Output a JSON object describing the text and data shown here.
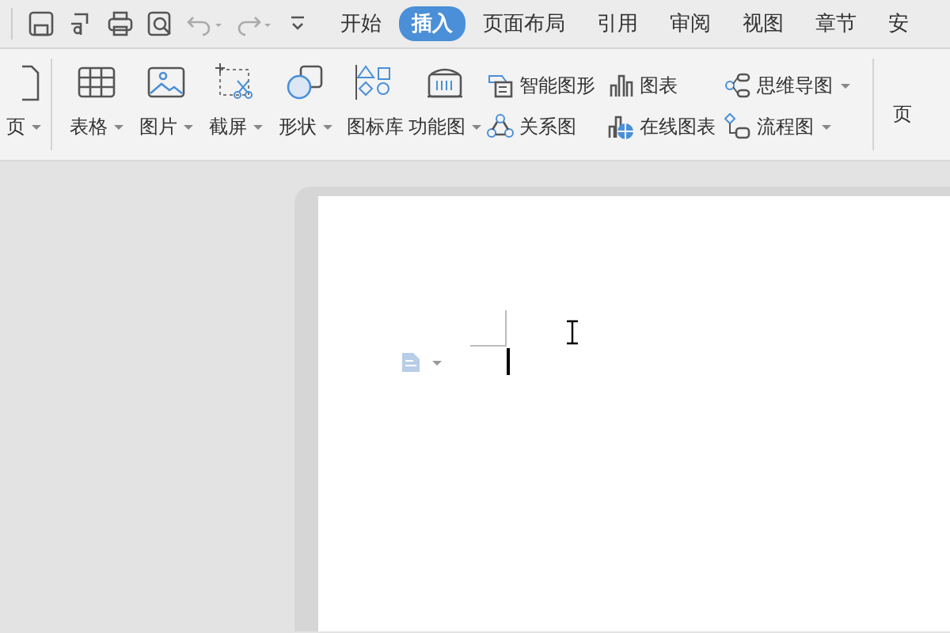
{
  "menu_tabs": [
    {
      "label": "开始",
      "selected": false
    },
    {
      "label": "插入",
      "selected": true
    },
    {
      "label": "页面布局",
      "selected": false
    },
    {
      "label": "引用",
      "selected": false
    },
    {
      "label": "审阅",
      "selected": false
    },
    {
      "label": "视图",
      "selected": false
    },
    {
      "label": "章节",
      "selected": false
    },
    {
      "label": "安",
      "selected": false
    }
  ],
  "ribbon": {
    "cut_left_button": {
      "label": "页",
      "dropdown": true
    },
    "large_buttons": [
      {
        "label": "表格",
        "dropdown": true
      },
      {
        "label": "图片",
        "dropdown": true
      },
      {
        "label": "截屏",
        "dropdown": true
      },
      {
        "label": "形状",
        "dropdown": true
      },
      {
        "label": "图标库",
        "dropdown": false
      },
      {
        "label": "功能图",
        "dropdown": true
      }
    ],
    "small_buttons": [
      {
        "label": "智能图形",
        "dropdown": false
      },
      {
        "label": "关系图",
        "dropdown": false
      },
      {
        "label": "图表",
        "dropdown": false
      },
      {
        "label": "在线图表",
        "dropdown": false
      },
      {
        "label": "思维导图",
        "dropdown": true
      },
      {
        "label": "流程图",
        "dropdown": true
      }
    ],
    "cut_right_button": {
      "label": "页"
    }
  }
}
